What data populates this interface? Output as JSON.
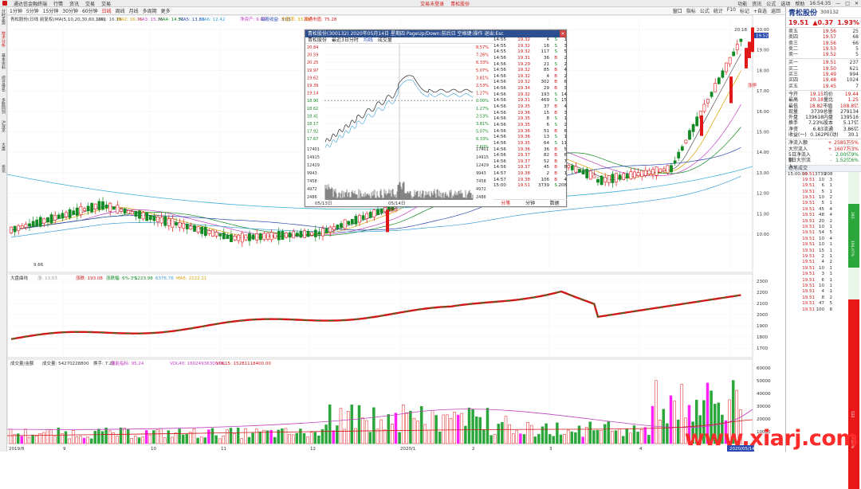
{
  "titlebar": {
    "app_title": "通达信金融终端",
    "menus": [
      "行情",
      "资讯",
      "交易",
      "交易"
    ],
    "center_items": [
      "交易未登录",
      "青松股份"
    ],
    "right_items": [
      "功能",
      "资讯",
      "公式",
      "选项",
      "帮助"
    ],
    "time": "16:54:35"
  },
  "toolbar": {
    "periods": [
      "1分钟",
      "5分钟",
      "15分钟",
      "30分钟",
      "60分钟",
      "日线",
      "周线",
      "月线",
      "多周期",
      "更多"
    ],
    "active_period": "日线",
    "right_items": [
      "窗口",
      "指标",
      "公式",
      "统计",
      "F10",
      "标记",
      "+自选",
      "返回"
    ]
  },
  "leftbar": {
    "items": [
      "分时走势",
      "技术分析",
      "基本资料",
      "综合排名",
      "多股同列",
      "沪深京",
      "大盘",
      "资讯"
    ]
  },
  "kline_legend": {
    "name": "青松股份(日线 前复权)",
    "ma_params": "MA(5,10,20,30,60,120)",
    "ma1": "MA1: 16.19",
    "ma2": "MA2: 16.76",
    "ma3": "MA3: 15.36",
    "ma4": "MA4: 14.51",
    "ma5": "MA5: 13.83",
    "ma6": "MA6: 12.42",
    "extra1": "净资产: 9.03",
    "extra2": "每股收益: 3.05",
    "extra3": "市盈率: 33.08",
    "extra4": "流通市值: 75.28"
  },
  "kline_yaxis": [
    "20.00",
    "19.00",
    "18.00",
    "17.00",
    "16.00",
    "15.00",
    "14.00",
    "13.00",
    "12.00",
    "11.00",
    "10.00"
  ],
  "kline_marks": {
    "high_label": "20.18",
    "price_tag": "19.52",
    "low_label": "9.66",
    "up_tag": "涨停",
    "up_tag2": "涨停"
  },
  "sub1_legend": {
    "name": "大盘曲线",
    "v1": "涨: 13.03",
    "v2": "涨跌: 193.08",
    "v3": "涨跌幅: 6%-3%",
    "v4": "1223.98",
    "v5": "6376.76",
    "v6": "MA5: 2122.11"
  },
  "sub1_yaxis": [
    "2300",
    "2200",
    "2100",
    "2000",
    "1900",
    "1800",
    "1700"
  ],
  "sub2_legend": {
    "name": "成交量/金额",
    "v1": "成交量: 54270228800",
    "v2": "换手: 7.23",
    "v3": "量能指标: 95.24",
    "v4": "VOL40: 16024936300.00",
    "v5": "VOL15: 15281118400.00"
  },
  "sub2_yaxis": [
    "60000",
    "50000",
    "40000",
    "30000",
    "20000",
    "10000"
  ],
  "xaxis": [
    "2019/8",
    "9",
    "10",
    "11",
    "12",
    "2020/1",
    "2",
    "3",
    "4",
    "2020/05/14/四"
  ],
  "popup": {
    "title": "青松股份(300132) 2020年05月14日 星期四 PageUp/Down:前后日 空格键:操作 退出:Esc",
    "tabs": [
      "青松股份",
      "最近3日分时",
      "均线",
      "成交量"
    ],
    "yaxis_left": [
      "20.84",
      "20.59",
      "20.25",
      "19.97",
      "19.62",
      "19.39",
      "19.14",
      "18.90",
      "18.62",
      "18.41",
      "18.17",
      "17.92",
      "17.67"
    ],
    "yaxis_right": [
      "8.57%",
      "7.26%",
      "6.33%",
      "5.07%",
      "3.81%",
      "2.53%",
      "1.27%",
      "0.00%",
      "1.27%",
      "2.53%",
      "3.81%",
      "5.07%",
      "6.33%",
      "7.60%"
    ],
    "vol_axis": [
      "17401",
      "14915",
      "12429",
      "9943",
      "7458",
      "4972",
      "2486"
    ],
    "date_labels": [
      "05/13日",
      "05/14日"
    ],
    "ticks": [
      [
        "14:55",
        "19.32",
        "4",
        "S",
        "1"
      ],
      [
        "14:55",
        "19.32",
        "16",
        "S",
        "3"
      ],
      [
        "14:55",
        "19.32",
        "117",
        "S",
        "5"
      ],
      [
        "14:56",
        "19.31",
        "36",
        "B",
        "2"
      ],
      [
        "14:56",
        "19.29",
        "21",
        "S",
        "2"
      ],
      [
        "14:56",
        "19.32",
        "85",
        "B",
        "4"
      ],
      [
        "14:56",
        "19.32",
        "4",
        "B",
        "2"
      ],
      [
        "14:56",
        "19.32",
        "302",
        "B",
        "6"
      ],
      [
        "14:56",
        "19.34",
        "29",
        "B",
        "3"
      ],
      [
        "14:56",
        "19.32",
        "193",
        "S",
        "14"
      ],
      [
        "14:56",
        "19.31",
        "469",
        "S",
        "15"
      ],
      [
        "14:56",
        "19.35",
        "37",
        "B",
        "4"
      ],
      [
        "14:56",
        "19.36",
        "15",
        "B",
        "3"
      ],
      [
        "14:56",
        "19.35",
        "8",
        "S",
        "1"
      ],
      [
        "14:56",
        "19.35",
        "6",
        "S",
        "2"
      ],
      [
        "14:56",
        "19.36",
        "51",
        "B",
        "6"
      ],
      [
        "14:56",
        "19.36",
        "13",
        "S",
        "1"
      ],
      [
        "14:56",
        "19.35",
        "64",
        "S",
        "11"
      ],
      [
        "14:56",
        "19.36",
        "36",
        "B",
        "5"
      ],
      [
        "14:56",
        "19.37",
        "82",
        "B",
        "6"
      ],
      [
        "14:56",
        "19.37",
        "52",
        "B",
        "7"
      ],
      [
        "14:56",
        "19.37",
        "45",
        "B",
        "8"
      ],
      [
        "14:57",
        "19.38",
        "2",
        "B",
        "1"
      ],
      [
        "14:57",
        "19.38",
        "106",
        "B",
        "4"
      ],
      [
        "15:00",
        "19.51",
        "3739",
        "S",
        "208"
      ]
    ],
    "foot": [
      "分笔",
      "分钟",
      "数据"
    ]
  },
  "right_panel": {
    "name": "青松股份",
    "code": "300132",
    "price": "19.51",
    "change": "▲0.37",
    "pct": "1.93%",
    "asks": [
      [
        "卖五",
        "19.56",
        "25"
      ],
      [
        "卖四",
        "19.57",
        "68"
      ],
      [
        "卖三",
        "19.56",
        "66"
      ],
      [
        "卖二",
        "19.53",
        "5"
      ],
      [
        "卖一",
        "19.52",
        "5"
      ]
    ],
    "bids": [
      [
        "买一",
        "19.51",
        "237"
      ],
      [
        "买二",
        "19.50",
        "621"
      ],
      [
        "买三",
        "19.49",
        "994"
      ],
      [
        "买四",
        "19.48",
        "1024"
      ],
      [
        "买五",
        "19.45",
        "7"
      ]
    ],
    "stats": [
      [
        "今开",
        "19.15",
        "均价",
        "19.44"
      ],
      [
        "最高",
        "20.18",
        "量比",
        "1.25"
      ],
      [
        "最低",
        "18.82",
        "市值",
        "108.8亿"
      ],
      [
        "现量",
        "3739",
        "总量",
        "279134"
      ],
      [
        "外盘",
        "139618",
        "内盘",
        "139516"
      ],
      [
        "换手",
        "7.23%",
        "股本",
        "5.17亿"
      ],
      [
        "净资",
        "6.83",
        "流通",
        "3.86亿"
      ],
      [
        "收益(一)",
        "0.162",
        "PE(动)",
        "30.1"
      ]
    ],
    "funds": [
      [
        "净流入额",
        "+",
        "2585万",
        "5%"
      ],
      [
        "大宗流入",
        "+",
        "1607万",
        "3%"
      ],
      [
        "5日净流入额",
        "-",
        "2.00亿",
        "9%"
      ],
      [
        "5日大宗流入",
        "-",
        "1.52亿",
        "6%"
      ]
    ],
    "tick_header": "逐笔成交",
    "ticks": [
      [
        "15:00:00",
        "19.51",
        "3739",
        "208"
      ],
      [
        "",
        "19.51",
        "10",
        "3"
      ],
      [
        "",
        "19.51",
        "6",
        "1"
      ],
      [
        "",
        "19.51",
        "5",
        "1"
      ],
      [
        "",
        "19.51",
        "10",
        "2"
      ],
      [
        "",
        "19.51",
        "5",
        "1"
      ],
      [
        "",
        "19.51",
        "45",
        "4"
      ],
      [
        "",
        "19.51",
        "48",
        "4"
      ],
      [
        "",
        "19.51",
        "20",
        "2"
      ],
      [
        "",
        "19.51",
        "10",
        "1"
      ],
      [
        "",
        "19.51",
        "54",
        "5"
      ],
      [
        "",
        "19.51",
        "10",
        "4"
      ],
      [
        "",
        "19.51",
        "10",
        "1"
      ],
      [
        "",
        "19.51",
        "15",
        "1"
      ],
      [
        "",
        "19.51",
        "2",
        "1"
      ],
      [
        "",
        "19.51",
        "4",
        "2"
      ],
      [
        "",
        "19.51",
        "10",
        "1"
      ],
      [
        "",
        "19.51",
        "3",
        "1"
      ],
      [
        "",
        "19.51",
        "6",
        "1"
      ],
      [
        "",
        "19.51",
        "10",
        "1"
      ],
      [
        "",
        "19.51",
        "4",
        "1"
      ],
      [
        "",
        "19.51",
        "8",
        "2"
      ],
      [
        "",
        "19.51",
        "47",
        "5"
      ],
      [
        "",
        "19.51",
        "100",
        "8"
      ]
    ],
    "vol_labels": [
      "283",
      "194.07%",
      "522",
      "97.07%"
    ]
  },
  "watermark": "www.xiarj.com",
  "colors": {
    "up": "#d01818",
    "down": "#138a23",
    "accent": "#2a4ab0"
  }
}
